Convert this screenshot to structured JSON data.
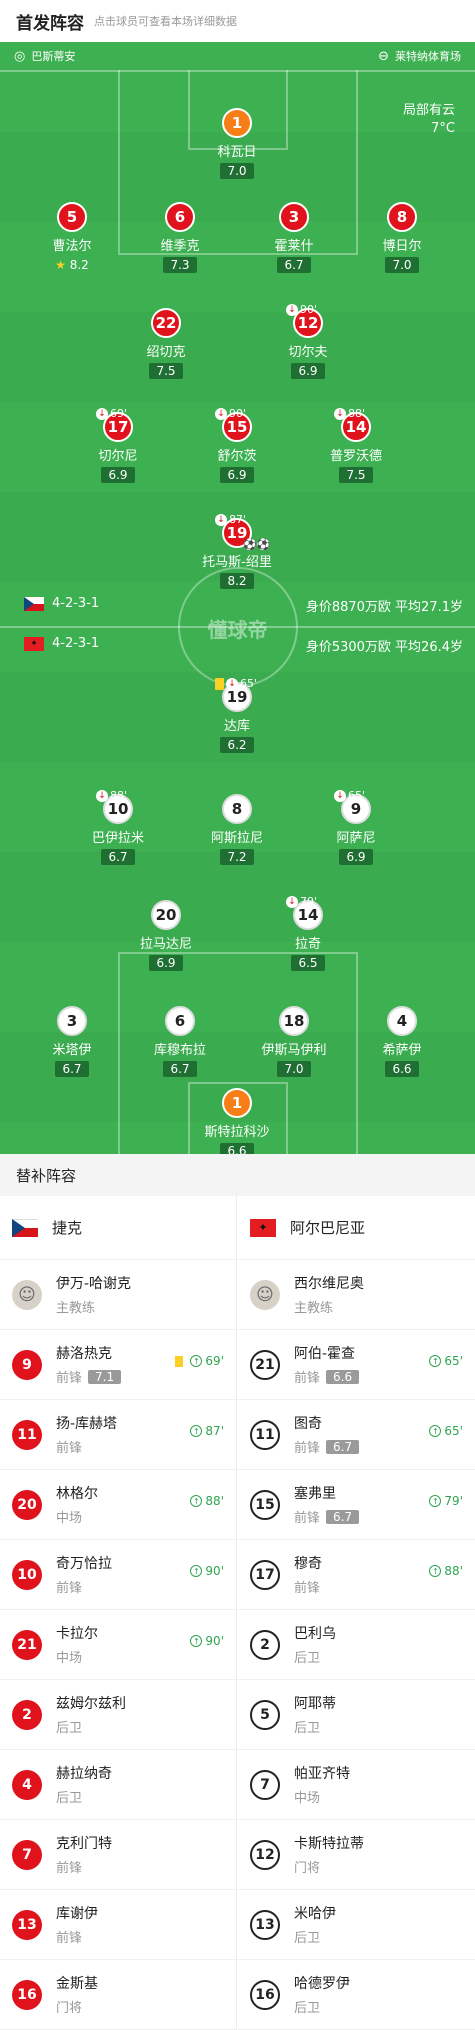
{
  "header": {
    "title": "首发阵容",
    "subtitle": "点击球员可查看本场详细数据"
  },
  "pitch_top": {
    "home_stadium_label": "巴斯蒂安",
    "venue": "莱特纳体育场"
  },
  "weather": {
    "condition": "局部有云",
    "temp": "7°C"
  },
  "watermark": "懂球帝",
  "home": {
    "formation": "4-2-3-1",
    "value": "身价8870万欧 平均27.1岁",
    "players": [
      {
        "num": "1",
        "name": "科瓦日",
        "rating": "7.0",
        "color": "orange"
      },
      {
        "num": "5",
        "name": "曹法尔",
        "rating": "8.2",
        "color": "red",
        "star": true
      },
      {
        "num": "6",
        "name": "维季克",
        "rating": "7.3",
        "color": "red"
      },
      {
        "num": "3",
        "name": "霍莱什",
        "rating": "6.7",
        "color": "red"
      },
      {
        "num": "8",
        "name": "博日尔",
        "rating": "7.0",
        "color": "red"
      },
      {
        "num": "22",
        "name": "绍切克",
        "rating": "7.5",
        "color": "red",
        "captain": true
      },
      {
        "num": "12",
        "name": "切尔夫",
        "rating": "6.9",
        "color": "red",
        "sub_min": "90'"
      },
      {
        "num": "17",
        "name": "切尔尼",
        "rating": "6.9",
        "color": "red",
        "sub_min": "69'"
      },
      {
        "num": "15",
        "name": "舒尔茨",
        "rating": "6.9",
        "color": "red",
        "sub_min": "90'"
      },
      {
        "num": "14",
        "name": "普罗沃德",
        "rating": "7.5",
        "color": "red",
        "sub_min": "88'"
      },
      {
        "num": "19",
        "name": "托马斯-绍里",
        "rating": "8.2",
        "color": "red",
        "sub_min": "87'",
        "goals": "⚽⚽"
      }
    ]
  },
  "away": {
    "formation": "4-2-3-1",
    "value": "身价5300万欧 平均26.4岁",
    "players": [
      {
        "num": "19",
        "name": "达库",
        "rating": "6.2",
        "color": "white",
        "sub_min": "65'",
        "yellow": true
      },
      {
        "num": "10",
        "name": "巴伊拉米",
        "rating": "6.7",
        "color": "white",
        "sub_min": "88'"
      },
      {
        "num": "8",
        "name": "阿斯拉尼",
        "rating": "7.2",
        "color": "white"
      },
      {
        "num": "9",
        "name": "阿萨尼",
        "rating": "6.9",
        "color": "white",
        "sub_min": "65'"
      },
      {
        "num": "20",
        "name": "拉马达尼",
        "rating": "6.9",
        "color": "white"
      },
      {
        "num": "14",
        "name": "拉奇",
        "rating": "6.5",
        "color": "white",
        "sub_min": "79'"
      },
      {
        "num": "3",
        "name": "米塔伊",
        "rating": "6.7",
        "color": "white"
      },
      {
        "num": "6",
        "name": "库穆布拉",
        "rating": "6.7",
        "color": "white"
      },
      {
        "num": "18",
        "name": "伊斯马伊利",
        "rating": "7.0",
        "color": "white"
      },
      {
        "num": "4",
        "name": "希萨伊",
        "rating": "6.6",
        "color": "white",
        "captain": true
      },
      {
        "num": "1",
        "name": "斯特拉科沙",
        "rating": "6.6",
        "color": "orange"
      }
    ]
  },
  "subs": {
    "title": "替补阵容",
    "home_team": "捷克",
    "away_team": "阿尔巴尼亚",
    "home_coach": {
      "name": "伊万-哈谢克",
      "role": "主教练"
    },
    "away_coach": {
      "name": "西尔维尼奥",
      "role": "主教练"
    },
    "home": [
      {
        "num": "9",
        "name": "赫洛热克",
        "pos": "前锋",
        "rating": "7.1",
        "in": "69'",
        "yellow": true
      },
      {
        "num": "11",
        "name": "扬-库赫塔",
        "pos": "前锋",
        "in": "87'"
      },
      {
        "num": "20",
        "name": "林格尔",
        "pos": "中场",
        "in": "88'"
      },
      {
        "num": "10",
        "name": "奇万恰拉",
        "pos": "前锋",
        "in": "90'"
      },
      {
        "num": "21",
        "name": "卡拉尔",
        "pos": "中场",
        "in": "90'"
      },
      {
        "num": "2",
        "name": "兹姆尔兹利",
        "pos": "后卫"
      },
      {
        "num": "4",
        "name": "赫拉纳奇",
        "pos": "后卫"
      },
      {
        "num": "7",
        "name": "克利门特",
        "pos": "前锋"
      },
      {
        "num": "13",
        "name": "库谢伊",
        "pos": "前锋"
      },
      {
        "num": "16",
        "name": "金斯基",
        "pos": "门将"
      }
    ],
    "away": [
      {
        "num": "21",
        "name": "阿伯-霍查",
        "pos": "前锋",
        "rating": "6.6",
        "in": "65'"
      },
      {
        "num": "11",
        "name": "图奇",
        "pos": "前锋",
        "rating": "6.7",
        "in": "65'"
      },
      {
        "num": "15",
        "name": "塞弗里",
        "pos": "前锋",
        "rating": "6.7",
        "in": "79'"
      },
      {
        "num": "17",
        "name": "穆奇",
        "pos": "前锋",
        "in": "88'"
      },
      {
        "num": "2",
        "name": "巴利乌",
        "pos": "后卫"
      },
      {
        "num": "5",
        "name": "阿耶蒂",
        "pos": "后卫"
      },
      {
        "num": "7",
        "name": "帕亚齐特",
        "pos": "中场"
      },
      {
        "num": "12",
        "name": "卡斯特拉蒂",
        "pos": "门将"
      },
      {
        "num": "13",
        "name": "米哈伊",
        "pos": "后卫"
      },
      {
        "num": "16",
        "name": "哈德罗伊",
        "pos": "后卫"
      }
    ]
  }
}
